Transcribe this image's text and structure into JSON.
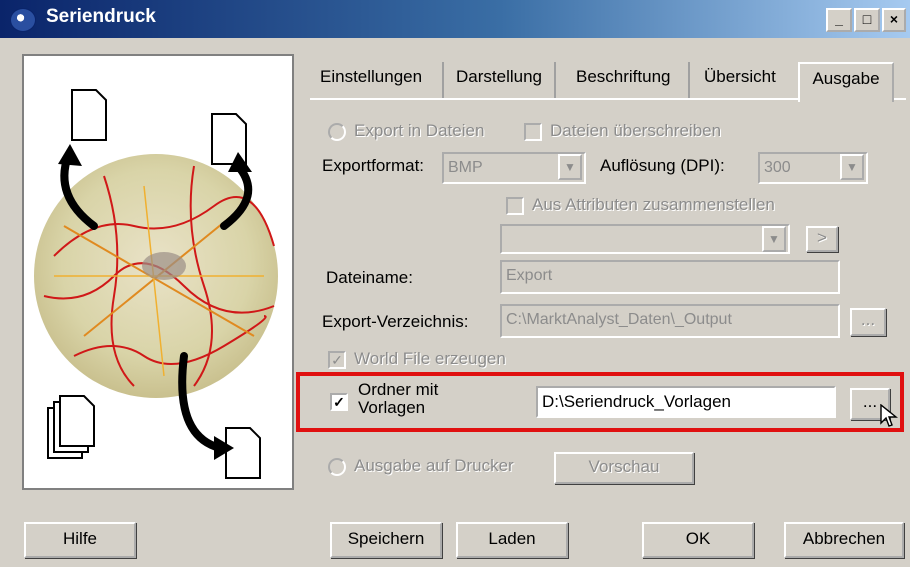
{
  "window": {
    "title": "Seriendruck"
  },
  "tabs": [
    "Einstellungen",
    "Darstellung",
    "Beschriftung",
    "Übersicht",
    "Ausgabe"
  ],
  "export": {
    "radio_label": "Export in Dateien",
    "overwrite_label": "Dateien überschreiben",
    "format_label": "Exportformat:",
    "format_value": "BMP",
    "dpi_label": "Auflösung (DPI):",
    "dpi_value": "300",
    "attrib_label": "Aus Attributen zusammenstellen",
    "attrib_value": "",
    "arrow_btn": ">",
    "filename_label": "Dateiname:",
    "filename_value": "Export",
    "dir_label": "Export-Verzeichnis:",
    "dir_value": "C:\\MarktAnalyst_Daten\\_Output",
    "browse_label": "...",
    "worldfile_label": "World File erzeugen"
  },
  "templates": {
    "label_line1": "Ordner mit",
    "label_line2": "Vorlagen",
    "path_value": "D:\\Seriendruck_Vorlagen",
    "browse_label": "..."
  },
  "printer": {
    "radio_label": "Ausgabe auf Drucker",
    "preview_btn": "Vorschau"
  },
  "footer": {
    "help": "Hilfe",
    "save": "Speichern",
    "load": "Laden",
    "ok": "OK",
    "cancel": "Abbrechen"
  },
  "icons": [
    "app-icon",
    "minimize-icon",
    "maximize-icon",
    "close-icon",
    "document-icon",
    "arrow-icon",
    "map-icon",
    "mouse-cursor-icon"
  ]
}
